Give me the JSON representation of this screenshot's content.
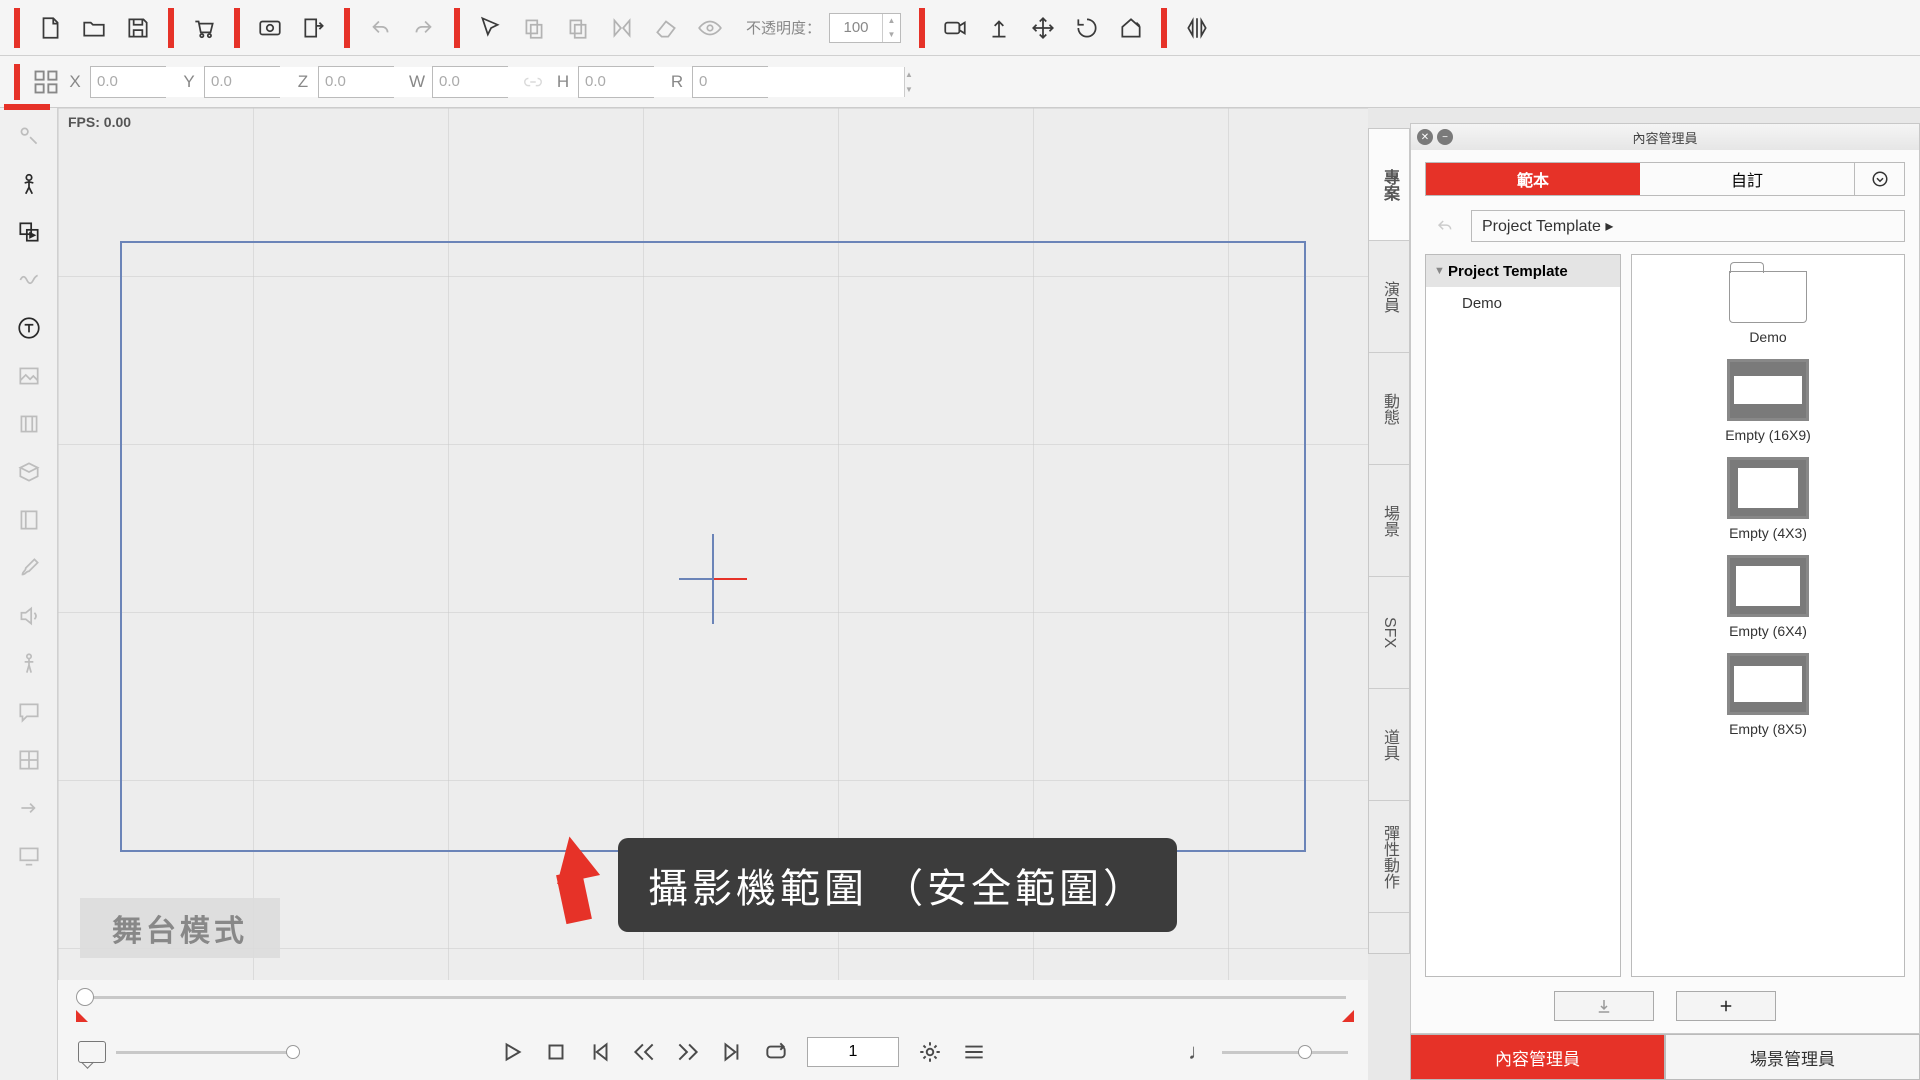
{
  "toolbar": {
    "opacity_label": "不透明度：",
    "opacity_value": "100"
  },
  "coords": {
    "x": "0.0",
    "y": "0.0",
    "z": "0.0",
    "w": "0.0",
    "h": "0.0",
    "r": "0"
  },
  "viewport": {
    "fps_label": "FPS: 0.00"
  },
  "mode_badge": "舞台模式",
  "callout_text": "攝影機範圍 （安全範圍）",
  "right_tabs": {
    "project": "專案",
    "actor": "演員",
    "motion": "動態",
    "scene": "場景",
    "sfx": "SFX",
    "props": "道具",
    "spring": "彈性動作"
  },
  "panel": {
    "title": "內容管理員",
    "tab_template": "範本",
    "tab_custom": "自訂",
    "breadcrumb": "Project Template ▸",
    "tree": {
      "root": "Project Template",
      "child1": "Demo"
    },
    "thumbs": {
      "demo": "Demo",
      "t169": "Empty (16X9)",
      "t43": "Empty (4X3)",
      "t64": "Empty (6X4)",
      "t85": "Empty (8X5)"
    }
  },
  "footer": {
    "content_mgr": "內容管理員",
    "scene_mgr": "場景管理員"
  },
  "playbar": {
    "frame": "1"
  }
}
